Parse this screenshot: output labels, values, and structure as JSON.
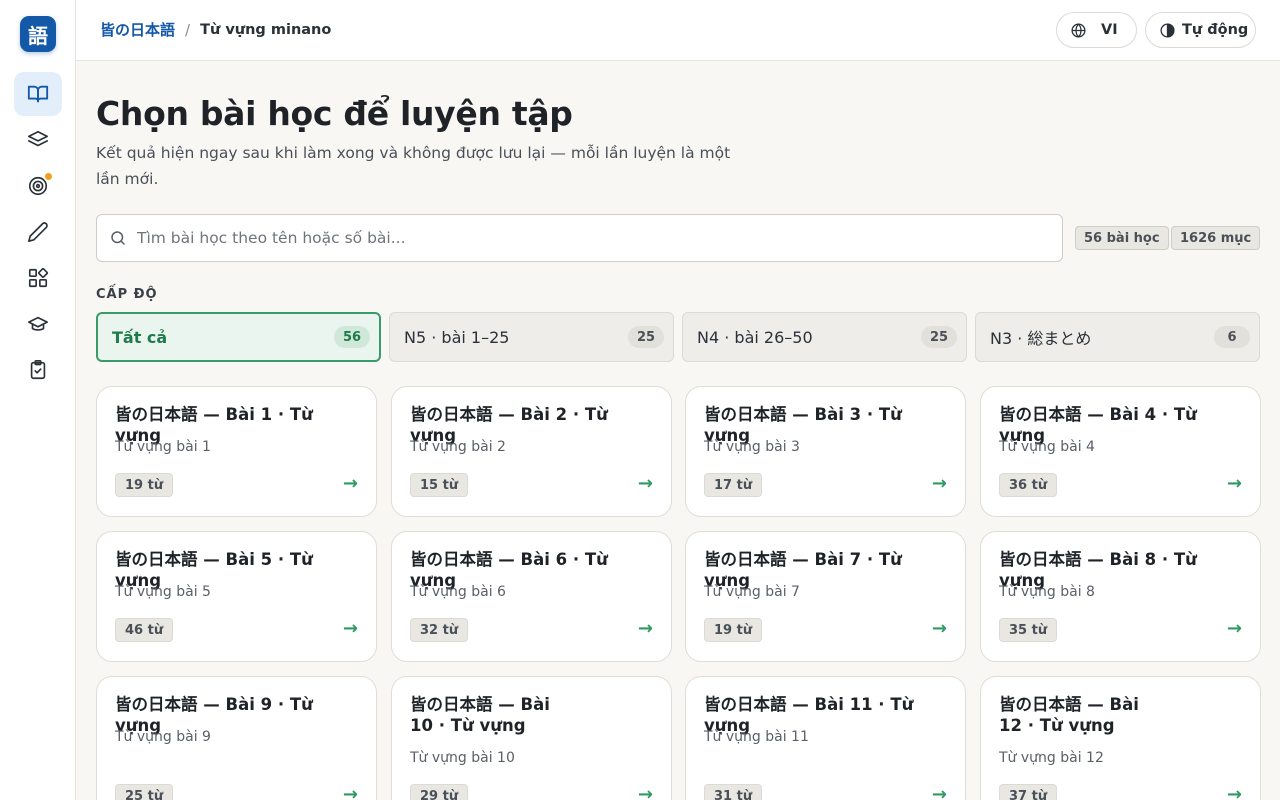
{
  "app": {
    "logo_glyph": "語",
    "accent_color": "#1458a8",
    "success_color": "#3a9b6a"
  },
  "sidebar": {
    "items": [
      {
        "icon": "book-open-icon",
        "active": true
      },
      {
        "icon": "layers-icon",
        "active": false
      },
      {
        "icon": "target-icon",
        "active": false,
        "has_dot": true
      },
      {
        "icon": "pencil-icon",
        "active": false
      },
      {
        "icon": "grid-icon",
        "active": false
      },
      {
        "icon": "graduation-cap-icon",
        "active": false
      },
      {
        "icon": "clipboard-check-icon",
        "active": false
      }
    ]
  },
  "header": {
    "breadcrumb_home": "皆の日本語",
    "breadcrumb_separator": "/",
    "breadcrumb_current": "Từ vựng minano",
    "language_label": "VI",
    "theme_label": "Tự động"
  },
  "main": {
    "title": "Chọn bài học để luyện tập",
    "subtitle": "Kết quả hiện ngay sau khi làm xong và không được lưu lại — mỗi lần luyện là một lần mới.",
    "search_placeholder": "Tìm bài học theo tên hoặc số bài...",
    "stat_lessons": "56 bài học",
    "stat_items": "1626 mục",
    "level_label": "CẤP ĐỘ",
    "levels": [
      {
        "label": "Tất cả",
        "count": "56",
        "active": true
      },
      {
        "label": "N5 · bài 1–25",
        "count": "25",
        "active": false
      },
      {
        "label": "N4 · bài 26–50",
        "count": "25",
        "active": false
      },
      {
        "label": "N3 · 総まとめ",
        "count": "6",
        "active": false
      }
    ],
    "lessons": [
      {
        "title": "皆の日本語 — Bài 1 · Từ vựng",
        "subtitle": "Từ vựng bài 1",
        "words": "19 từ"
      },
      {
        "title": "皆の日本語 — Bài 2 · Từ vựng",
        "subtitle": "Từ vựng bài 2",
        "words": "15 từ"
      },
      {
        "title": "皆の日本語 — Bài 3 · Từ vựng",
        "subtitle": "Từ vựng bài 3",
        "words": "17 từ"
      },
      {
        "title": "皆の日本語 — Bài 4 · Từ vựng",
        "subtitle": "Từ vựng bài 4",
        "words": "36 từ"
      },
      {
        "title": "皆の日本語 — Bài 5 · Từ vựng",
        "subtitle": "Từ vựng bài 5",
        "words": "46 từ"
      },
      {
        "title": "皆の日本語 — Bài 6 · Từ vựng",
        "subtitle": "Từ vựng bài 6",
        "words": "32 từ"
      },
      {
        "title": "皆の日本語 — Bài 7 · Từ vựng",
        "subtitle": "Từ vựng bài 7",
        "words": "19 từ"
      },
      {
        "title": "皆の日本語 — Bài 8 · Từ vựng",
        "subtitle": "Từ vựng bài 8",
        "words": "35 từ"
      },
      {
        "title": "皆の日本語 — Bài 9 · Từ vựng",
        "subtitle": "Từ vựng bài 9",
        "words": "25 từ"
      },
      {
        "title": "皆の日本語 — Bài 10 · Từ vựng",
        "subtitle": "Từ vựng bài 10",
        "words": "29 từ"
      },
      {
        "title": "皆の日本語 — Bài 11 · Từ vựng",
        "subtitle": "Từ vựng bài 11",
        "words": "31 từ"
      },
      {
        "title": "皆の日本語 — Bài 12 · Từ vựng",
        "subtitle": "Từ vựng bài 12",
        "words": "37 từ"
      }
    ],
    "arrow_glyph": "→"
  }
}
